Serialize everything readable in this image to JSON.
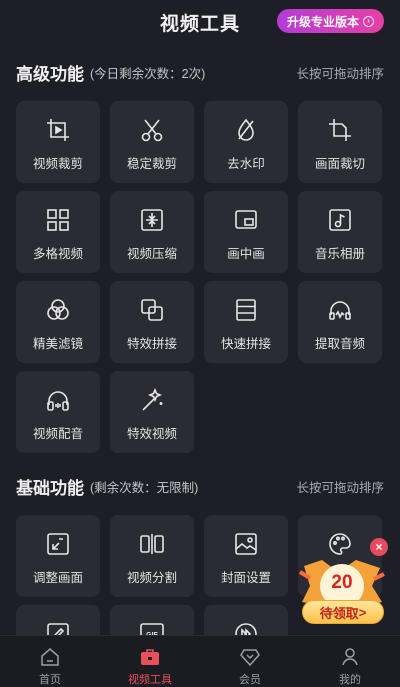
{
  "header": {
    "title": "视频工具",
    "upgrade_label": "升级专业版本"
  },
  "advanced": {
    "title": "高级功能",
    "quota": "(今日剩余次数：2次)",
    "hint": "长按可拖动排序",
    "items": [
      {
        "label": "视频裁剪",
        "icon": "crop-play-icon"
      },
      {
        "label": "稳定裁剪",
        "icon": "scissors-icon"
      },
      {
        "label": "去水印",
        "icon": "watermark-remove-icon"
      },
      {
        "label": "画面裁切",
        "icon": "crop-icon"
      },
      {
        "label": "多格视频",
        "icon": "grid-icon"
      },
      {
        "label": "视频压缩",
        "icon": "compress-icon"
      },
      {
        "label": "画中画",
        "icon": "picture-in-picture-icon"
      },
      {
        "label": "音乐相册",
        "icon": "music-album-icon"
      },
      {
        "label": "精美滤镜",
        "icon": "filter-circles-icon"
      },
      {
        "label": "特效拼接",
        "icon": "overlap-squares-icon"
      },
      {
        "label": "快速拼接",
        "icon": "stack-icon"
      },
      {
        "label": "提取音频",
        "icon": "headphones-wave-icon"
      },
      {
        "label": "视频配音",
        "icon": "headphones-icon"
      },
      {
        "label": "特效视频",
        "icon": "magic-wand-icon"
      }
    ]
  },
  "basic": {
    "title": "基础功能",
    "quota": "(剩余次数：无限制)",
    "hint": "长按可拖动排序",
    "items": [
      {
        "label": "调整画面",
        "icon": "resize-icon"
      },
      {
        "label": "视频分割",
        "icon": "split-icon"
      },
      {
        "label": "封面设置",
        "icon": "cover-image-icon"
      },
      {
        "label": "",
        "icon": "palette-icon"
      },
      {
        "label": "",
        "icon": "edit-icon"
      },
      {
        "label": "",
        "icon": "gif-icon"
      },
      {
        "label": "",
        "icon": "fast-forward-icon"
      }
    ]
  },
  "promo": {
    "amount": "20",
    "claim_label": "待领取",
    "close": "×"
  },
  "nav": {
    "items": [
      {
        "label": "首页",
        "icon": "home-icon"
      },
      {
        "label": "视频工具",
        "icon": "toolbox-icon"
      },
      {
        "label": "会员",
        "icon": "diamond-icon"
      },
      {
        "label": "我的",
        "icon": "user-icon"
      }
    ]
  },
  "colors": {
    "background": "#1e1f26",
    "tile": "#2a2b33",
    "accent_active": "#e8505b",
    "upgrade_gradient": [
      "#b53cd8",
      "#e640a4"
    ]
  }
}
